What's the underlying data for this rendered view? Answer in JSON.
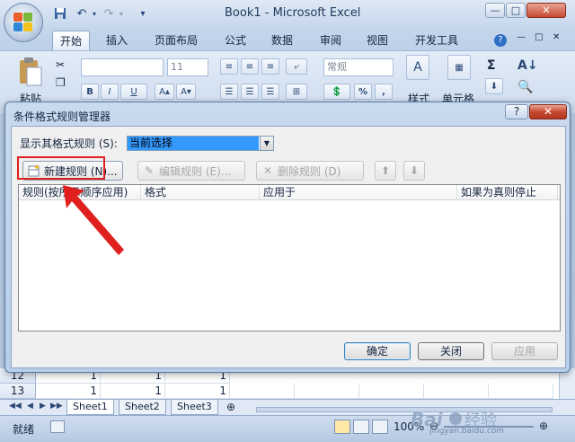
{
  "window": {
    "title": "Book1 - Microsoft Excel"
  },
  "quick_access": {
    "save_icon": "save-icon",
    "undo_icon": "undo-icon",
    "redo_icon": "redo-icon"
  },
  "ribbon": {
    "tabs": [
      "开始",
      "插入",
      "页面布局",
      "公式",
      "数据",
      "审阅",
      "视图",
      "开发工具"
    ],
    "paste_label": "粘贴",
    "font_size": "11",
    "number_format": "常规",
    "styles_label": "样式",
    "cells_label": "单元格",
    "bold": "B",
    "italic": "I",
    "underline": "U",
    "percent": "%",
    "comma": ","
  },
  "dialog": {
    "title": "条件格式规则管理器",
    "show_rules_label": "显示其格式规则 (S):",
    "scope_value": "当前选择",
    "new_rule": "新建规则 (N)...",
    "edit_rule": "编辑规则 (E)...",
    "delete_rule": "删除规则 (D)",
    "columns": [
      "规则(按所示顺序应用)",
      "格式",
      "应用于",
      "如果为真则停止"
    ],
    "ok": "确定",
    "close": "关闭",
    "apply": "应用"
  },
  "grid": {
    "rows": [
      {
        "row": "12",
        "values": [
          "1",
          "1",
          "1"
        ]
      },
      {
        "row": "13",
        "values": [
          "1",
          "1",
          "1"
        ]
      }
    ]
  },
  "sheets": [
    "Sheet1",
    "Sheet2",
    "Sheet3"
  ],
  "status": {
    "ready": "就绪",
    "zoom": "100%"
  },
  "watermark": {
    "site": "jingyan.baidu.com"
  },
  "colors": {
    "highlight": "#e0201e",
    "selection": "#3399ff"
  }
}
